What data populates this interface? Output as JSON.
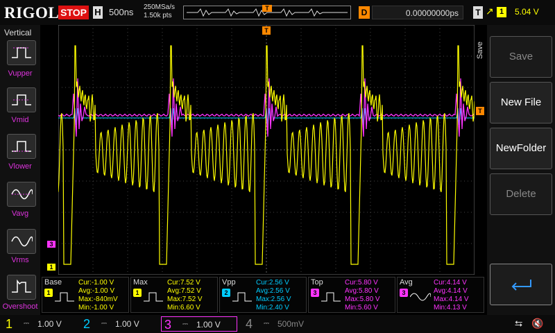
{
  "header": {
    "brand": "RIGOL",
    "run_state": "STOP",
    "h_label": "H",
    "timebase": "500ns",
    "sample_rate": "250MSa/s",
    "memory_depth": "1.50k pts",
    "delay_label": "D",
    "delay_value": "0.00000000ps",
    "trigger_label": "T",
    "trigger_source": "1",
    "trigger_level": "5.04 V",
    "trigger_marker": "T"
  },
  "left_menu": {
    "title": "Vertical",
    "items": [
      {
        "label": "Vupper",
        "icon": "pulse-upper-icon"
      },
      {
        "label": "Vmid",
        "icon": "pulse-mid-icon"
      },
      {
        "label": "Vlower",
        "icon": "pulse-lower-icon"
      },
      {
        "label": "Vavg",
        "icon": "sine-avg-icon"
      },
      {
        "label": "Vrms",
        "icon": "sine-rms-icon"
      },
      {
        "label": "Overshoot",
        "icon": "overshoot-icon"
      }
    ]
  },
  "channel_markers": {
    "ch3": "3",
    "ch1": "1"
  },
  "measurements": [
    {
      "name": "Base",
      "channel": "1",
      "color": "#ffff00",
      "cur": "Cur:-1.00 V",
      "avg": "Avg:-1.00 V",
      "max": "Max:-840mV",
      "min": "Min:-1.00 V"
    },
    {
      "name": "Max",
      "channel": "1",
      "color": "#ffff00",
      "cur": "Cur:7.52 V",
      "avg": "Avg:7.52 V",
      "max": "Max:7.52 V",
      "min": "Min:6.60 V"
    },
    {
      "name": "Vpp",
      "channel": "2",
      "color": "#00ccff",
      "cur": "Cur:2.56 V",
      "avg": "Avg:2.56 V",
      "max": "Max:2.56 V",
      "min": "Min:2.40 V"
    },
    {
      "name": "Top",
      "channel": "3",
      "color": "#ff33ff",
      "cur": "Cur:5.80 V",
      "avg": "Avg:5.80 V",
      "max": "Max:5.80 V",
      "min": "Min:5.60 V"
    },
    {
      "name": "Avg",
      "channel": "3",
      "color": "#ff33ff",
      "cur": "Cur:4.14 V",
      "avg": "Avg:4.14 V",
      "max": "Max:4.14 V",
      "min": "Min:4.13 V"
    }
  ],
  "right_menu": {
    "tab": "Save",
    "buttons": [
      {
        "label": "Save",
        "enabled": false
      },
      {
        "label": "New File",
        "enabled": true
      },
      {
        "label": "NewFolder",
        "enabled": true
      },
      {
        "label": "Delete",
        "enabled": false
      }
    ],
    "enter_icon": "enter-return-icon"
  },
  "channels": [
    {
      "num": "1",
      "scale": "1.00 V",
      "color": "#ffff00",
      "active": true
    },
    {
      "num": "2",
      "scale": "1.00 V",
      "color": "#00ccff",
      "active": true
    },
    {
      "num": "3",
      "scale": "1.00 V",
      "color": "#ff33ff",
      "active": true,
      "selected": true
    },
    {
      "num": "4",
      "scale": "500mV",
      "color": "#888888",
      "active": false
    }
  ],
  "status_icons": [
    "usb-icon",
    "speaker-mute-icon"
  ]
}
